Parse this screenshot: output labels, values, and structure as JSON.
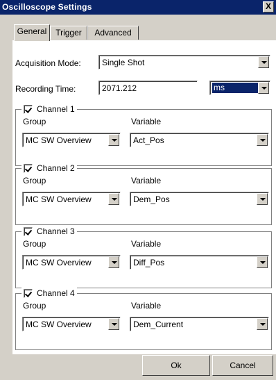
{
  "window": {
    "title": "Oscilloscope Settings",
    "close_glyph": "X"
  },
  "tabs": [
    {
      "label": "General",
      "active": true
    },
    {
      "label": "Trigger",
      "active": false
    },
    {
      "label": "Advanced",
      "active": false
    }
  ],
  "acquisition": {
    "label": "Acquisition Mode:",
    "value": "Single Shot"
  },
  "recording": {
    "label": "Recording Time:",
    "value": "2071.212",
    "unit": "ms"
  },
  "channels": [
    {
      "title": "Channel 1",
      "checked": true,
      "group_label": "Group",
      "variable_label": "Variable",
      "group_value": "MC SW Overview",
      "variable_value": "Act_Pos"
    },
    {
      "title": "Channel 2",
      "checked": true,
      "group_label": "Group",
      "variable_label": "Variable",
      "group_value": "MC SW Overview",
      "variable_value": "Dem_Pos"
    },
    {
      "title": "Channel 3",
      "checked": true,
      "group_label": "Group",
      "variable_label": "Variable",
      "group_value": "MC SW Overview",
      "variable_value": "Diff_Pos"
    },
    {
      "title": "Channel 4",
      "checked": true,
      "group_label": "Group",
      "variable_label": "Variable",
      "group_value": "MC SW Overview",
      "variable_value": "Dem_Current"
    }
  ],
  "buttons": {
    "ok": "Ok",
    "cancel": "Cancel"
  },
  "colors": {
    "titlebar": "#0a246a",
    "face": "#d4d0c8",
    "page": "#ffffff"
  }
}
